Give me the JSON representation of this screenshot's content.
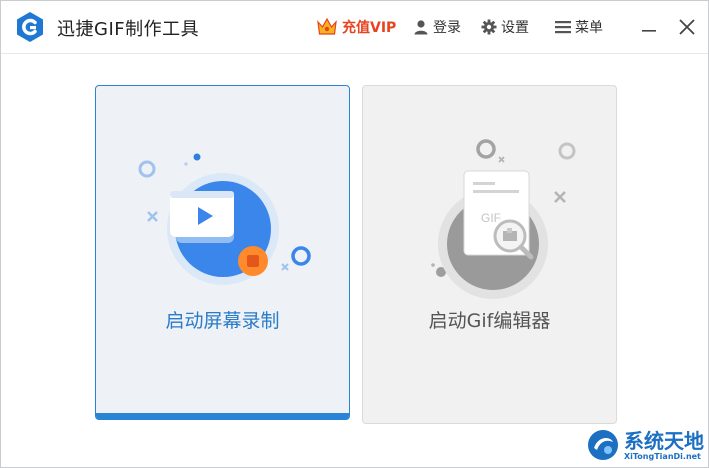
{
  "app": {
    "title": "迅捷GIF制作工具"
  },
  "toolbar": {
    "vip_label": "充值VIP",
    "login_label": "登录",
    "settings_label": "设置",
    "menu_label": "菜单"
  },
  "cards": {
    "record_label": "启动屏幕录制",
    "editor_label": "启动Gif编辑器"
  },
  "watermark": {
    "title": "系统天地",
    "url": "XiTongTianDi.net"
  },
  "colors": {
    "accent": "#2a84d6",
    "vip": "#e8421f",
    "card_selected_bg": "#eef2f6",
    "card_disabled_bg": "#f1f1f1"
  }
}
